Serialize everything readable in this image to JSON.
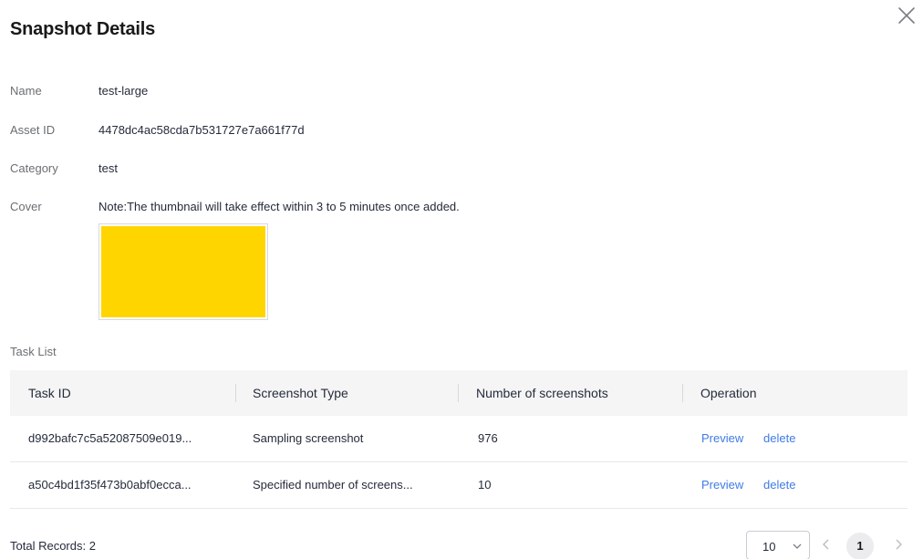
{
  "dialog": {
    "title": "Snapshot Details",
    "close_icon": "close-icon"
  },
  "details": {
    "name_label": "Name",
    "name_value": "test-large",
    "asset_id_label": "Asset ID",
    "asset_id_value": "4478dc4ac58cda7b531727e7a661f77d",
    "category_label": "Category",
    "category_value": "test",
    "cover_label": "Cover",
    "cover_note": "Note:The thumbnail will take effect within 3 to 5 minutes once added.",
    "cover_color": "#FFD500"
  },
  "task_list": {
    "label": "Task List",
    "columns": [
      "Task ID",
      "Screenshot Type",
      "Number of screenshots",
      "Operation"
    ],
    "rows": [
      {
        "task_id": "d992bafc7c5a52087509e019...",
        "type": "Sampling screenshot",
        "count": "976",
        "preview": "Preview",
        "delete": "delete"
      },
      {
        "task_id": "a50c4bd1f35f473b0abf0ecca...",
        "type": "Specified number of screens...",
        "count": "10",
        "preview": "Preview",
        "delete": "delete"
      }
    ]
  },
  "pagination": {
    "total": "Total Records: 2",
    "page_size": "10",
    "current_page": "1",
    "icons": [
      "chevron-down-icon",
      "chevron-left-icon",
      "chevron-right-icon"
    ]
  },
  "colors": {
    "link": "#3F7BE6",
    "header_bg": "#F5F5F6",
    "label": "#6B6E73"
  }
}
